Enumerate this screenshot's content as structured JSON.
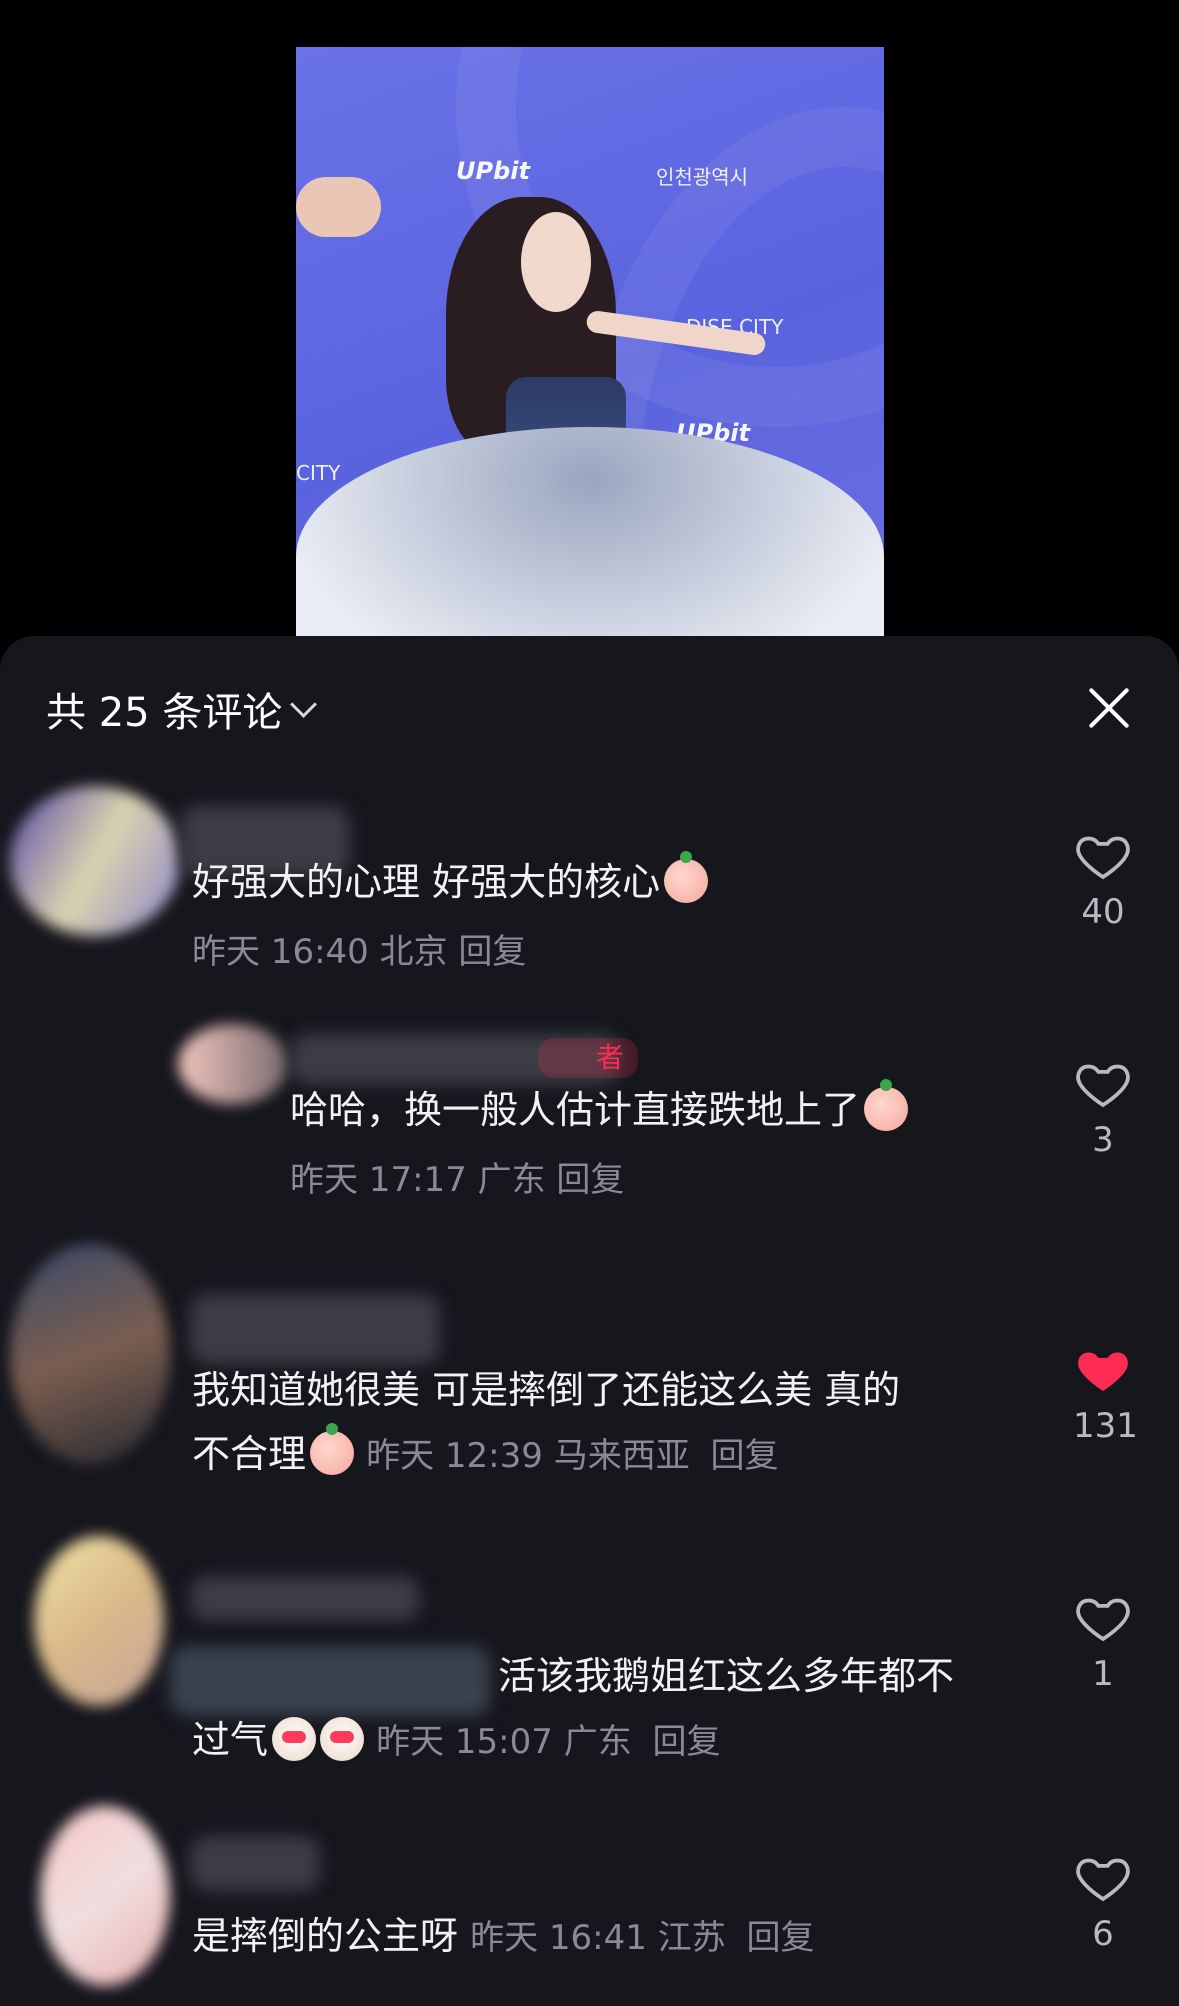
{
  "header": {
    "title": "共 25 条评论"
  },
  "comments": [
    {
      "text": "好强大的心理 好强大的核心",
      "time": "昨天 16:40",
      "location": "北京",
      "reply": "回复",
      "likes": "40",
      "liked": false
    },
    {
      "text": "哈哈，换一般人估计直接跌地上了",
      "time": "昨天 17:17",
      "location": "广东",
      "reply": "回复",
      "likes": "3",
      "liked": false,
      "tag": "者"
    },
    {
      "text_line1": "我知道她很美 可是摔倒了还能这么美 真的",
      "text_line2": "不合理",
      "time": "昨天 12:39",
      "location": "马来西亚",
      "reply": "回复",
      "likes": "131",
      "liked": true
    },
    {
      "text_line1": "活该我鹅姐红这么多年都不",
      "text_line2": "过气",
      "time": "昨天 15:07",
      "location": "广东",
      "reply": "回复",
      "likes": "1",
      "liked": false
    },
    {
      "text": "是摔倒的公主呀",
      "time": "昨天 16:41",
      "location": "江苏",
      "reply": "回复",
      "likes": "6",
      "liked": false
    }
  ],
  "video": {
    "brand_a": "UPbit",
    "brand_b": "인천광역시",
    "brand_c": "DISE CITY",
    "brand_d": "UPbit",
    "brand_e": "CITY"
  },
  "colors": {
    "background": "#000000",
    "sheet": "#16161d",
    "liked_heart": "#fe2c55",
    "meta": "#8a8a93"
  }
}
